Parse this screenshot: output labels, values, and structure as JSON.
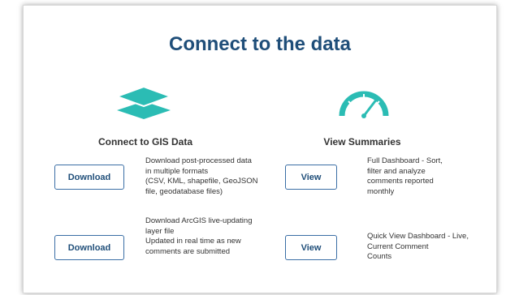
{
  "title": "Connect to the data",
  "left": {
    "icon": "layers-icon",
    "heading": "Connect to GIS Data",
    "rows": [
      {
        "button": "Download",
        "lines": [
          "Download post-processed data",
          "in multiple formats",
          "(CSV, KML, shapefile, GeoJSON",
          "file, geodatabase files)"
        ]
      },
      {
        "button": "Download",
        "lines": [
          "Download ArcGIS live-updating",
          "layer file",
          "Updated in real time as new",
          "comments are submitted"
        ]
      }
    ]
  },
  "right": {
    "icon": "speedometer-icon",
    "heading": "View Summaries",
    "rows": [
      {
        "button": "View",
        "lines": [
          "Full Dashboard - Sort,",
          "filter and analyze",
          "comments reported",
          "monthly"
        ]
      },
      {
        "button": "View",
        "lines": [
          "Quick View Dashboard - Live,",
          "Current Comment",
          "Counts"
        ]
      }
    ]
  },
  "colors": {
    "title": "#1f4e79",
    "accent": "#2bbcb4",
    "button_border": "#3a6ea5"
  }
}
